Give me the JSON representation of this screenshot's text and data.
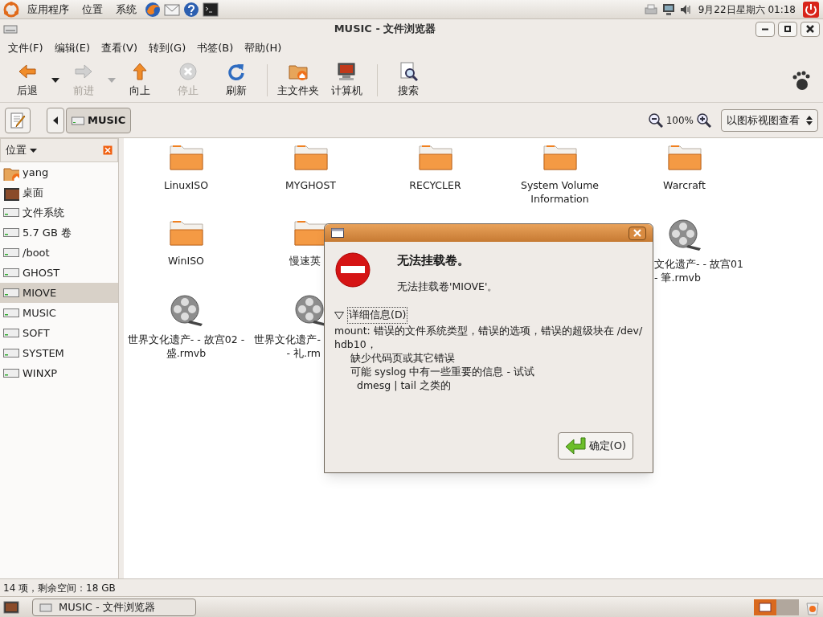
{
  "top_panel": {
    "menus": [
      "应用程序",
      "位置",
      "系统"
    ],
    "launchers": [
      {
        "kind": "browser"
      },
      {
        "kind": "mail"
      },
      {
        "kind": "help"
      },
      {
        "kind": "terminal"
      }
    ],
    "clock": "9月22日星期六 01:18"
  },
  "window": {
    "title": "MUSIC - 文件浏览器"
  },
  "menu_bar": [
    "文件(F)",
    "编辑(E)",
    "查看(V)",
    "转到(G)",
    "书签(B)",
    "帮助(H)"
  ],
  "toolbar": [
    {
      "kind": "back",
      "label": "后退",
      "disabled": false,
      "has_menu": true
    },
    {
      "kind": "forward",
      "label": "前进",
      "disabled": true,
      "has_menu": true
    },
    {
      "kind": "up",
      "label": "向上",
      "disabled": false,
      "has_menu": false
    },
    {
      "kind": "stop",
      "label": "停止",
      "disabled": true,
      "has_menu": false
    },
    {
      "kind": "reload",
      "label": "刷新",
      "disabled": false,
      "has_menu": false
    },
    {
      "kind": "sep"
    },
    {
      "kind": "home",
      "label": "主文件夹",
      "disabled": false,
      "has_menu": false
    },
    {
      "kind": "computer",
      "label": "计算机",
      "disabled": false,
      "has_menu": false
    },
    {
      "kind": "sep"
    },
    {
      "kind": "search",
      "label": "搜索",
      "disabled": false,
      "has_menu": false
    }
  ],
  "location_bar": {
    "path": [
      "MUSIC"
    ],
    "zoom": "100%",
    "view": "以图标视图查看"
  },
  "sidebar": {
    "title": "位置",
    "items": [
      {
        "kind": "home",
        "label": "yang",
        "selected": false
      },
      {
        "kind": "desktop",
        "label": "桌面",
        "selected": false
      },
      {
        "kind": "drive",
        "label": "文件系统",
        "selected": false
      },
      {
        "kind": "drive",
        "label": "5.7 GB 卷",
        "selected": false
      },
      {
        "kind": "drive",
        "label": "/boot",
        "selected": false
      },
      {
        "kind": "drive",
        "label": "GHOST",
        "selected": false
      },
      {
        "kind": "drive",
        "label": "MIOVE",
        "selected": true
      },
      {
        "kind": "drive",
        "label": "MUSIC",
        "selected": false
      },
      {
        "kind": "drive",
        "label": "SOFT",
        "selected": false
      },
      {
        "kind": "drive",
        "label": "SYSTEM",
        "selected": false
      },
      {
        "kind": "drive",
        "label": "WINXP",
        "selected": false
      }
    ]
  },
  "files": [
    {
      "kind": "folder",
      "label": "LinuxISO"
    },
    {
      "kind": "folder",
      "label": "MYGHOST"
    },
    {
      "kind": "folder",
      "label": "RECYCLER"
    },
    {
      "kind": "folder",
      "label": "System Volume Information"
    },
    {
      "kind": "folder",
      "label": "Warcraft"
    },
    {
      "kind": "folder",
      "label": "WinISO"
    },
    {
      "kind": "folder",
      "label": "慢速英"
    },
    {
      "kind": "hidden"
    },
    {
      "kind": "hidden"
    },
    {
      "kind": "video",
      "label": "文化遗产- - 故宫01 -  筆.rmvb"
    },
    {
      "kind": "video",
      "label": "世界文化遗产- - 故宫02 -  盛.rmvb"
    },
    {
      "kind": "video",
      "label": "世界文化遗产- -  礼.rm"
    }
  ],
  "status_bar": "14 项，剩余空间：18 GB",
  "dialog": {
    "heading": "无法挂载卷。",
    "message": "无法挂载卷'MIOVE'。",
    "details_label": "详细信息(D)",
    "expanded": true,
    "details": [
      "mount: 错误的文件系统类型，错误的选项，错误的超级块在 /dev/hdb10，",
      "缺少代码页或其它错误",
      "可能 syslog 中有一些重要的信息 - 试试",
      "dmesg | tail 之类的"
    ],
    "button": "确定(O)"
  },
  "taskbar": {
    "tasks": [
      {
        "label": "MUSIC - 文件浏览器"
      }
    ]
  }
}
